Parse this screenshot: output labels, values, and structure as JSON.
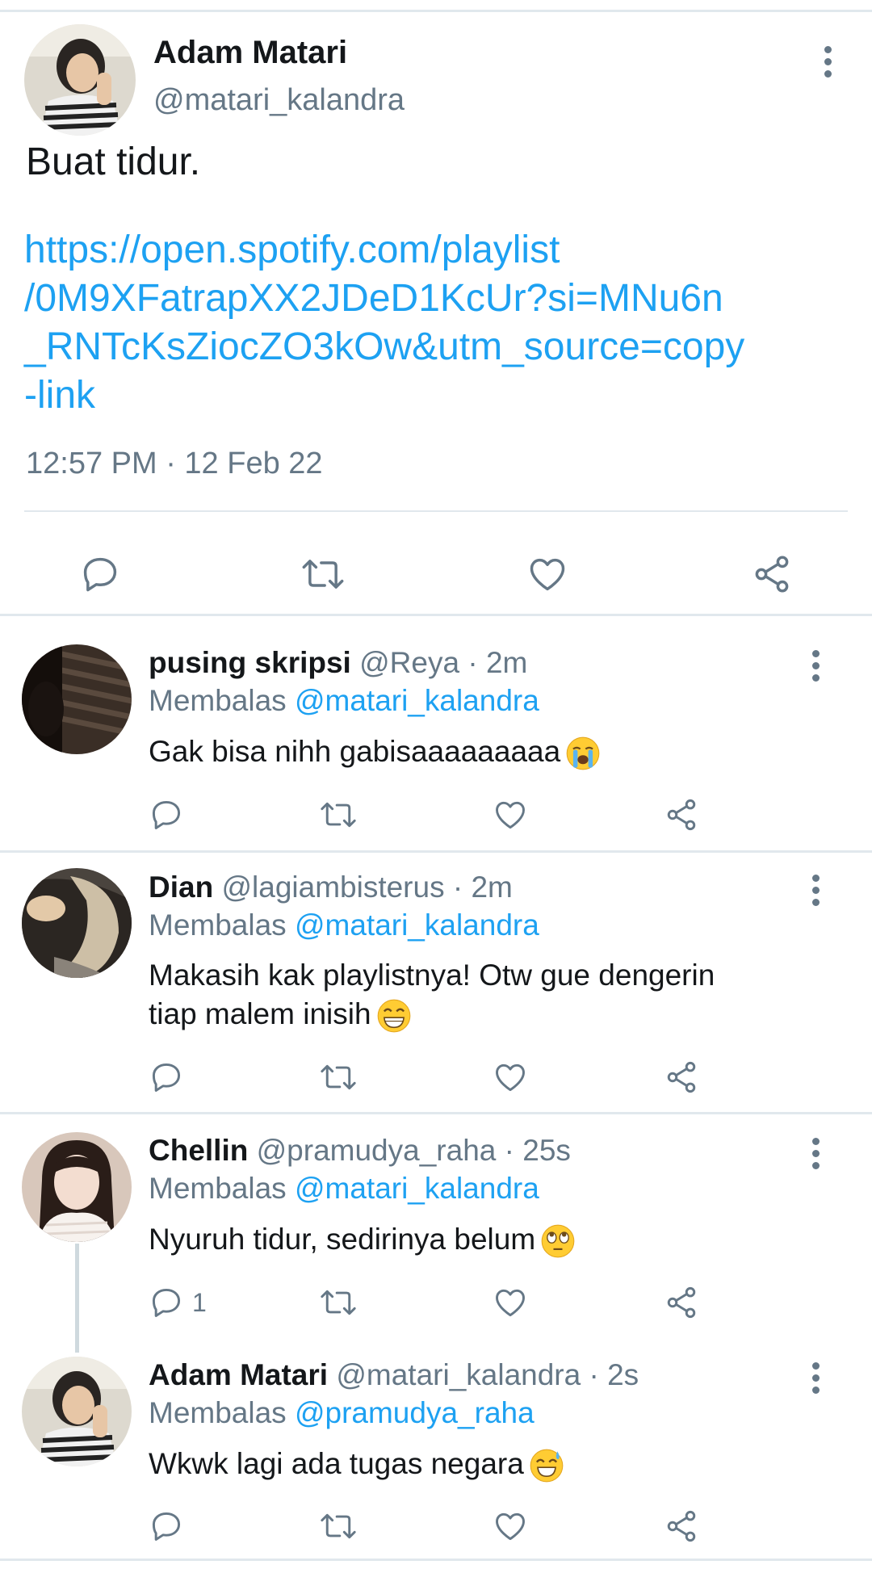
{
  "main_tweet": {
    "author_name": "Adam Matari",
    "author_handle": "@matari_kalandra",
    "text": "Buat tidur.",
    "link_lines": [
      "https://open.spotify.com/playlist",
      "/0M9XFatrapXX2JDeD1KcUr?si=MNu6n",
      "_RNTcKsZiocZO3kOw&utm_source=copy",
      "-link"
    ],
    "timestamp": "12:57 PM · 12 Feb 22",
    "actions": [
      "reply-icon",
      "retweet-icon",
      "like-icon",
      "share-icon"
    ]
  },
  "replies": [
    {
      "name": "pusing skripsi",
      "handle": "@Reya",
      "dot": " · ",
      "time": "2m",
      "replying_label": "Membalas ",
      "replying_to": "@matari_kalandra",
      "text": "Gak bisa nihh gabisaaaaaaaaa",
      "emoji": "loudly-crying-face-emoji",
      "reply_count": ""
    },
    {
      "name": "Dian",
      "handle": "@lagiambisterus",
      "dot": " · ",
      "time": "2m",
      "replying_label": "Membalas ",
      "replying_to": "@matari_kalandra",
      "text_line1": "Makasih kak playlistnya! Otw gue dengerin",
      "text_line2": "tiap malem inisih",
      "emoji": "grinning-face-emoji",
      "reply_count": ""
    },
    {
      "name": "Chellin",
      "handle": "@pramudya_raha",
      "dot": " · ",
      "time": "25s",
      "replying_label": "Membalas ",
      "replying_to": "@matari_kalandra",
      "text": "Nyuruh tidur, sedirinya belum",
      "emoji": "eye-roll-emoji",
      "reply_count": "1"
    },
    {
      "name": "Adam Matari",
      "handle": "@matari_kalandra",
      "dot": " · ",
      "time": "2s",
      "replying_label": "Membalas ",
      "replying_to": "@pramudya_raha",
      "text": "Wkwk lagi ada tugas negara",
      "emoji": "sweat-smile-emoji",
      "reply_count": ""
    }
  ],
  "colors": {
    "link": "#1da1f2",
    "secondary_text": "#657786",
    "divider": "#e1e8ed"
  }
}
